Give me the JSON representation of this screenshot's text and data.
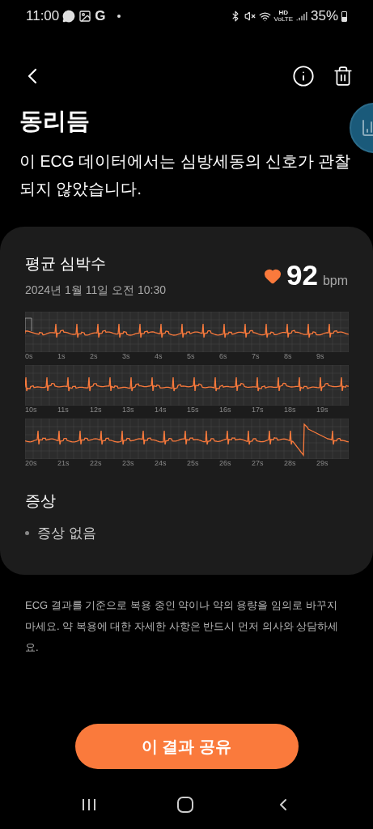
{
  "status_bar": {
    "time": "11:00",
    "app_letter": "G",
    "hd": "HD",
    "volte": "VoLTE",
    "battery": "35%"
  },
  "header": {
    "title": "동리듬",
    "description": "이 ECG 데이터에서는 심방세동의 신호가 관찰되지 않았습니다."
  },
  "card": {
    "heart_rate_label": "평균 심박수",
    "date": "2024년 1월 11일 오전 10:30",
    "heart_rate": "92",
    "unit": "bpm",
    "strips": [
      {
        "kind": "calibrated",
        "ticks": [
          "0s",
          "1s",
          "2s",
          "3s",
          "4s",
          "5s",
          "6s",
          "7s",
          "8s",
          "9s"
        ]
      },
      {
        "kind": "normal",
        "ticks": [
          "10s",
          "11s",
          "12s",
          "13s",
          "14s",
          "15s",
          "16s",
          "17s",
          "18s",
          "19s"
        ]
      },
      {
        "kind": "artifact",
        "ticks": [
          "20s",
          "21s",
          "22s",
          "23s",
          "24s",
          "25s",
          "26s",
          "27s",
          "28s",
          "29s"
        ]
      }
    ],
    "symptoms_title": "증상",
    "symptoms": [
      "증상 없음"
    ]
  },
  "disclaimer": "ECG 결과를 기준으로 복용 중인 약이나 약의 용량을 임의로 바꾸지 마세요. 약 복용에 대한 자세한 사항은 반드시 먼저 의사와 상담하세요.",
  "share_button": "이 결과 공유"
}
